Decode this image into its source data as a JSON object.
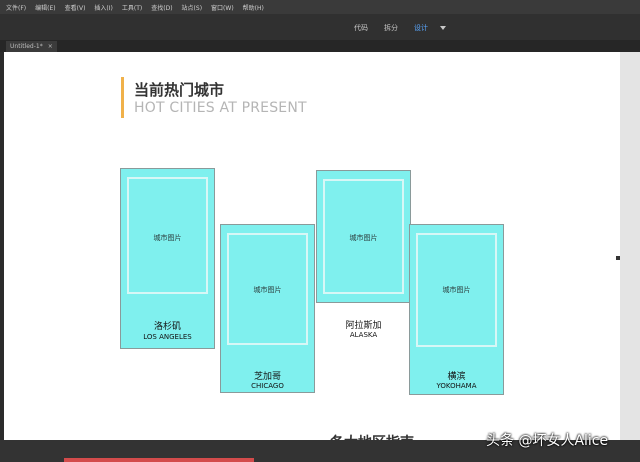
{
  "menu": [
    "文件(F)",
    "编辑(E)",
    "查看(V)",
    "插入(I)",
    "工具(T)",
    "查找(D)",
    "站点(S)",
    "窗口(W)",
    "帮助(H)"
  ],
  "view_buttons": {
    "code": "代码",
    "split": "拆分",
    "design": "设计"
  },
  "document_tab": {
    "title": "Untitled-1*",
    "close": "×"
  },
  "section": {
    "title_cn": "当前热门城市",
    "title_en": "HOT CITIES AT PRESENT"
  },
  "cards": [
    {
      "placeholder": "城市图片",
      "name_cn": "洛杉矶",
      "name_en": "LOS ANGELES"
    },
    {
      "placeholder": "城市图片",
      "name_cn": "芝加哥",
      "name_en": "CHICAGO"
    },
    {
      "placeholder": "城市图片",
      "name_cn": "阿拉斯加",
      "name_en": "ALASKA"
    },
    {
      "placeholder": "城市图片",
      "name_cn": "横滨",
      "name_en": "YOKOHAMA"
    }
  ],
  "next_section_title": "各大地区指南",
  "watermark": "头条 @坏女人Alice",
  "colors": {
    "accent": "#f0b14a",
    "card": "#7ff0ee",
    "active_view": "#5aa8ff"
  }
}
